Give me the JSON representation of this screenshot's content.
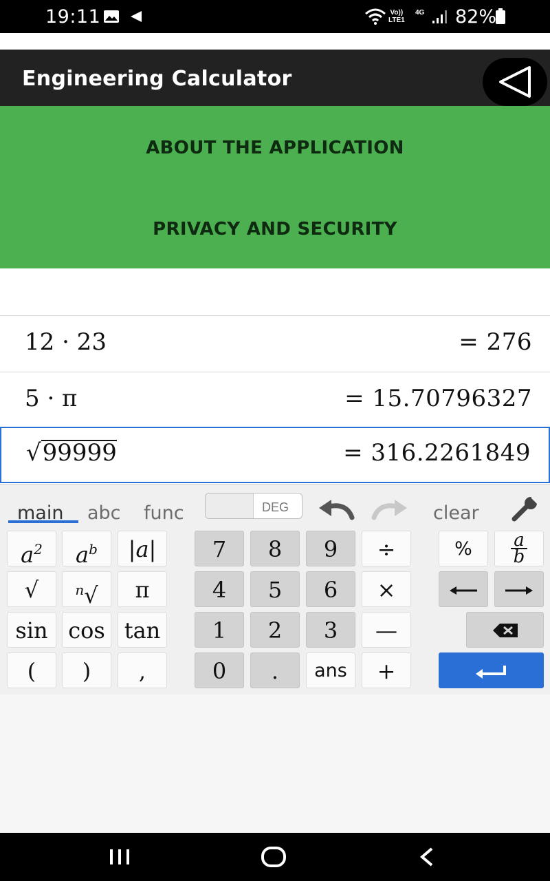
{
  "status_bar": {
    "time": "19:11",
    "volte_line1": "Vo))",
    "volte_line2": "LTE1",
    "network": "4G",
    "battery": "82%"
  },
  "app_bar": {
    "title": "Engineering Calculator"
  },
  "menu": {
    "items": [
      {
        "label": "ABOUT THE APPLICATION"
      },
      {
        "label": "PRIVACY AND SECURITY"
      }
    ]
  },
  "history": {
    "rows": [
      {
        "expression": "12 · 23",
        "result": "= 276"
      },
      {
        "expression": "5 · π",
        "result": "= 15.70796327"
      },
      {
        "expression_radicand": "99999",
        "result": "= 316.2261849"
      }
    ]
  },
  "keyboard": {
    "tabs": [
      "main",
      "abc",
      "func"
    ],
    "active_tab": "main",
    "angle_mode": "DEG",
    "clear_label": "clear",
    "keys": {
      "square": "a",
      "square_exp": "2",
      "power": "a",
      "power_exp": "b",
      "abs": "|a|",
      "sqrt": "√",
      "nth_root_n": "n",
      "nth_root_sym": "√",
      "pi": "π",
      "sin": "sin",
      "cos": "cos",
      "tan": "tan",
      "lparen": "(",
      "rparen": ")",
      "comma": ",",
      "seven": "7",
      "eight": "8",
      "nine": "9",
      "four": "4",
      "five": "5",
      "six": "6",
      "one": "1",
      "two": "2",
      "three": "3",
      "zero": "0",
      "dot": ".",
      "ans": "ans",
      "divide": "÷",
      "multiply": "×",
      "minus": "—",
      "plus": "+",
      "percent": "%",
      "frac_num": "a",
      "frac_den": "b"
    }
  },
  "colors": {
    "app_bar": "#222222",
    "menu_green": "#4caf50",
    "accent_blue": "#2a6fd6"
  },
  "icons": {
    "back": "triangle-left-icon",
    "undo": "undo-arrow-icon",
    "redo": "redo-arrow-icon",
    "settings": "wrench-icon",
    "backspace": "backspace-icon",
    "enter": "enter-icon"
  }
}
